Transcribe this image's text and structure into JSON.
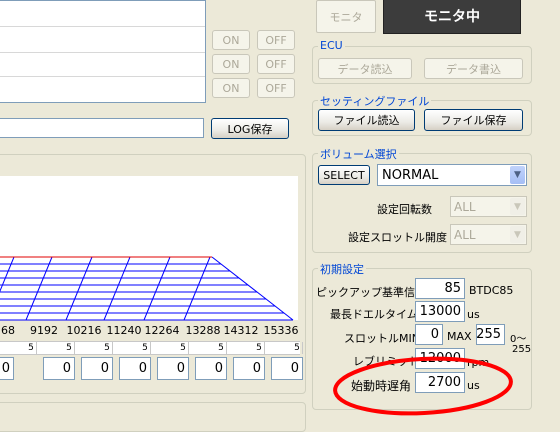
{
  "monitor": {
    "monitor_label": "モニタ",
    "monitoring_label": "モニタ中"
  },
  "switch_rows": [
    {
      "on": "ON",
      "off": "OFF"
    },
    {
      "on": "ON",
      "off": "OFF"
    },
    {
      "on": "ON",
      "off": "OFF"
    }
  ],
  "log": {
    "save_label": "LOG保存"
  },
  "ecu": {
    "title": "ECU",
    "read_label": "データ読込",
    "write_label": "データ書込"
  },
  "settings_file": {
    "title": "セッティングファイル",
    "read_label": "ファイル読込",
    "save_label": "ファイル保存"
  },
  "volume": {
    "title": "ボリューム選択",
    "select_label": "SELECT",
    "mode_value": "NORMAL",
    "rpm_count_label": "設定回転数",
    "rpm_count_value": "ALL",
    "throttle_label": "設定スロットル開度",
    "throttle_value": "ALL"
  },
  "initial": {
    "title": "初期設定",
    "pickup_label": "ピックアップ基準信号",
    "pickup_value": "85",
    "pickup_unit": "BTDC85",
    "dwell_label": "最長ドエルタイム",
    "dwell_value": "13000",
    "dwell_unit": "us",
    "throttle_min_label": "スロットルMIN",
    "throttle_min_value": "0",
    "max_label": "MAX",
    "throttle_max_value": "255",
    "range_top": "0～",
    "range_bottom": "255",
    "rev_limit_label": "レブリミット",
    "rev_limit_value": "12000",
    "rev_limit_unit": "rpm",
    "start_delay_label": "始動時遅角",
    "start_delay_value": "2700",
    "start_delay_unit": "us"
  },
  "table": {
    "rpm_headers": [
      "68",
      "9192",
      "10216",
      "11240",
      "12264",
      "13288",
      "14312",
      "15336"
    ],
    "step_values": [
      "5",
      "5",
      "5",
      "5",
      "5",
      "5",
      "5",
      "5"
    ],
    "cell_values": [
      "0",
      "0",
      "0",
      "0",
      "0",
      "0",
      "0",
      "0"
    ]
  },
  "colors": {
    "grid_line": "#0000FF",
    "grid_top": "#E00000",
    "annotation": "#FF0000",
    "accent_blue": "#0046D5",
    "monitoring_bg": "#3C3C3C"
  }
}
